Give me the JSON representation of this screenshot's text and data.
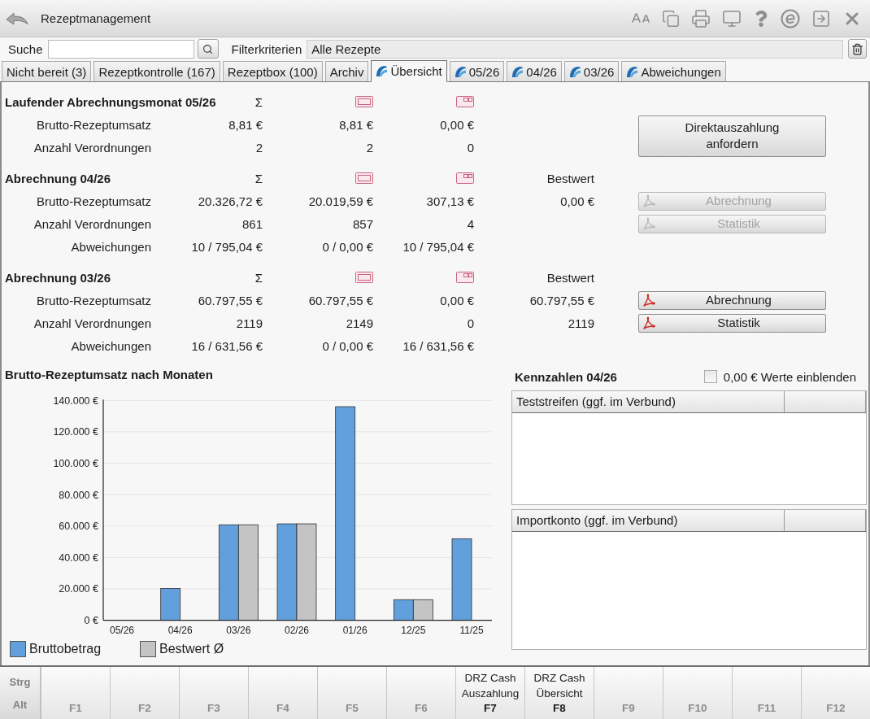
{
  "window": {
    "title": "Rezeptmanagement"
  },
  "search": {
    "label": "Suche"
  },
  "filter": {
    "label": "Filterkriterien",
    "value": "Alle Rezepte"
  },
  "tabs": [
    {
      "label": "Nicht bereit (3)",
      "selected": false,
      "icon": false
    },
    {
      "label": "Rezeptkontrolle (167)",
      "selected": false,
      "icon": false
    },
    {
      "label": "Rezeptbox (100)",
      "selected": false,
      "icon": false
    },
    {
      "label": "Archiv",
      "selected": false,
      "icon": false
    },
    {
      "label": "Übersicht",
      "selected": true,
      "icon": true
    },
    {
      "label": "05/26",
      "selected": false,
      "icon": true
    },
    {
      "label": "04/26",
      "selected": false,
      "icon": true
    },
    {
      "label": "03/26",
      "selected": false,
      "icon": true
    },
    {
      "label": "Abweichungen",
      "selected": false,
      "icon": true
    }
  ],
  "sections": [
    {
      "title": "Laufender Abrechnungsmonat 05/26",
      "columns": [
        {
          "kind": "text",
          "label": "Σ"
        },
        {
          "kind": "card"
        },
        {
          "kind": "card-split"
        }
      ],
      "rows": [
        {
          "label": "Brutto-Rezeptumsatz",
          "cells": [
            "8,81 €",
            "8,81 €",
            "0,00 €"
          ]
        },
        {
          "label": "Anzahl Verordnungen",
          "cells": [
            "2",
            "2",
            "0"
          ]
        }
      ],
      "side_button": {
        "label": "Direktauszahlung anfordern",
        "disabled": false
      }
    },
    {
      "title": "Abrechnung 04/26",
      "columns": [
        {
          "kind": "text",
          "label": "Σ"
        },
        {
          "kind": "card"
        },
        {
          "kind": "card-split"
        },
        {
          "kind": "text",
          "label": "Bestwert"
        }
      ],
      "rows": [
        {
          "label": "Brutto-Rezeptumsatz",
          "cells": [
            "20.326,72 €",
            "20.019,59 €",
            "307,13 €",
            "0,00 €"
          ],
          "button": {
            "label": "Abrechnung",
            "disabled": true
          }
        },
        {
          "label": "Anzahl Verordnungen",
          "cells": [
            "861",
            "857",
            "4"
          ],
          "button": {
            "label": "Statistik",
            "disabled": true
          }
        },
        {
          "label": "Abweichungen",
          "cells": [
            "10 / 795,04 €",
            "0 / 0,00 €",
            "10 / 795,04 €"
          ]
        }
      ]
    },
    {
      "title": "Abrechnung 03/26",
      "columns": [
        {
          "kind": "text",
          "label": "Σ"
        },
        {
          "kind": "card"
        },
        {
          "kind": "card-split"
        },
        {
          "kind": "text",
          "label": "Bestwert"
        }
      ],
      "rows": [
        {
          "label": "Brutto-Rezeptumsatz",
          "cells": [
            "60.797,55 €",
            "60.797,55 €",
            "0,00 €",
            "60.797,55 €"
          ],
          "button": {
            "label": "Abrechnung",
            "disabled": false
          }
        },
        {
          "label": "Anzahl Verordnungen",
          "cells": [
            "2119",
            "2149",
            "0",
            "2119"
          ],
          "button": {
            "label": "Statistik",
            "disabled": false
          }
        },
        {
          "label": "Abweichungen",
          "cells": [
            "16 / 631,56 €",
            "0 / 0,00 €",
            "16 / 631,56 €"
          ]
        }
      ]
    }
  ],
  "chart": {
    "title": "Brutto-Rezeptumsatz nach Monaten",
    "chart_data": {
      "type": "bar",
      "categories": [
        "05/26",
        "04/26",
        "03/26",
        "02/26",
        "01/26",
        "12/25",
        "11/25"
      ],
      "series": [
        {
          "name": "Bruttobetrag",
          "color": "#62a0dd",
          "values": [
            0,
            20300,
            60800,
            61400,
            136000,
            13100,
            51900
          ]
        },
        {
          "name": "Bestwert Ø",
          "color": "#c4c4c4",
          "values": [
            null,
            0,
            60800,
            61400,
            null,
            13100,
            null
          ]
        }
      ],
      "ylim": [
        0,
        140000
      ],
      "yticks": [
        {
          "value": 0,
          "label": "0 €"
        },
        {
          "value": 20000,
          "label": "20.000 €"
        },
        {
          "value": 40000,
          "label": "40.000 €"
        },
        {
          "value": 60000,
          "label": "60.000 €"
        },
        {
          "value": 80000,
          "label": "80.000 €"
        },
        {
          "value": 100000,
          "label": "100.000 €"
        },
        {
          "value": 120000,
          "label": "120.000 €"
        },
        {
          "value": 140000,
          "label": "140.000 €"
        }
      ],
      "grid": true,
      "legend": true
    }
  },
  "kennzahlen": {
    "title": "Kennzahlen 04/26",
    "show_zero": {
      "label": "0,00 € Werte einblenden",
      "checked": false
    },
    "tables": [
      {
        "header": "Teststreifen (ggf. im Verbund)"
      },
      {
        "header": "Importkonto (ggf. im Verbund)"
      }
    ]
  },
  "function_keys": {
    "modifiers": [
      "Strg",
      "Alt"
    ],
    "keys": [
      {
        "key": "F1",
        "disabled": true
      },
      {
        "key": "F2",
        "disabled": true
      },
      {
        "key": "F3",
        "disabled": true
      },
      {
        "key": "F4",
        "disabled": true
      },
      {
        "key": "F5",
        "disabled": true
      },
      {
        "key": "F6",
        "disabled": true
      },
      {
        "key": "F7",
        "label": "DRZ Cash Auszahlung",
        "disabled": false
      },
      {
        "key": "F8",
        "label": "DRZ Cash Übersicht",
        "disabled": false
      },
      {
        "key": "F9",
        "disabled": true
      },
      {
        "key": "F10",
        "disabled": true
      },
      {
        "key": "F11",
        "disabled": true
      },
      {
        "key": "F12",
        "disabled": true
      }
    ]
  }
}
